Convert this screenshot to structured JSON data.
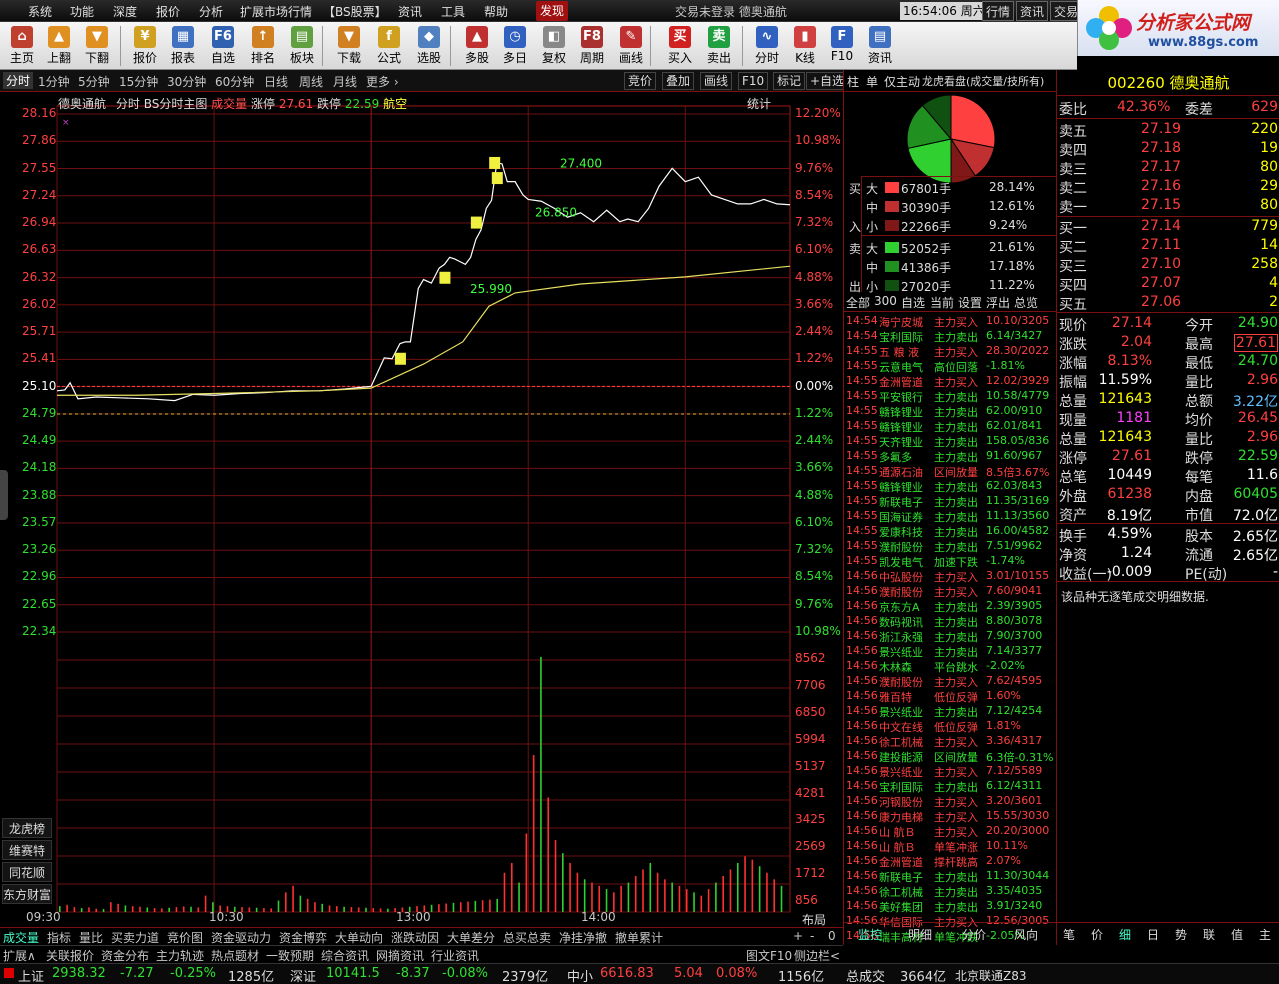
{
  "menu": {
    "items": [
      "系统",
      "功能",
      "深度",
      "报价",
      "分析",
      "扩展市场行情",
      "【BS股票】",
      "资讯",
      "工具",
      "帮助"
    ],
    "discover": "发现",
    "window_title": "交易未登录  德奥通航",
    "clock": "16:54:06",
    "weekday": "周六",
    "right_buttons": [
      "行情",
      "资讯",
      "交易"
    ]
  },
  "logo": {
    "name": "分析家公式网",
    "url": "www.88gs.com"
  },
  "toolbar": [
    "主页",
    "上翻",
    "下翻",
    "报价",
    "报表",
    "自选",
    "排名",
    "板块",
    "下载",
    "公式",
    "选股",
    "多股",
    "多日",
    "复权",
    "周期",
    "画线",
    "买入",
    "卖出",
    "分时",
    "K线",
    "F10",
    "资讯"
  ],
  "period_tabs": {
    "items": [
      "分时",
      "1分钟",
      "5分钟",
      "15分钟",
      "30分钟",
      "60分钟",
      "日线",
      "周线",
      "月线",
      "更多"
    ],
    "buttons": [
      "竞价",
      "叠加",
      "画线",
      "F10",
      "标记",
      "+自选"
    ]
  },
  "chart": {
    "stock": "德奥通航",
    "mode": "分时",
    "formula": "BS分时主图",
    "vol_label": "成交量",
    "limit_up_label": "涨停",
    "limit_up": "27.61",
    "limit_down_label": "跌停",
    "limit_down": "22.59",
    "sector": "航空",
    "stats": "统计",
    "prev_close": 25.1,
    "annotations": [
      {
        "price": 27.4,
        "label": "27.400",
        "side": "卖"
      },
      {
        "price": 25.99,
        "label": "25.990",
        "side": "卖"
      },
      {
        "price": 26.85,
        "label": "26.850",
        "side": "卖"
      }
    ],
    "left_axis": [
      "28.16",
      "27.86",
      "27.55",
      "27.24",
      "26.94",
      "26.63",
      "26.32",
      "26.02",
      "25.71",
      "25.41",
      "25.10",
      "24.79",
      "24.49",
      "24.18",
      "23.88",
      "23.57",
      "23.26",
      "22.96",
      "22.65",
      "22.34"
    ],
    "right_axis": [
      "12.20%",
      "10.98%",
      "9.76%",
      "8.54%",
      "7.32%",
      "6.10%",
      "4.88%",
      "3.66%",
      "2.44%",
      "1.22%",
      "0.00%",
      "1.22%",
      "2.44%",
      "3.66%",
      "4.88%",
      "6.10%",
      "7.32%",
      "8.54%",
      "9.76%",
      "10.98%"
    ],
    "vol_axis": [
      "8562",
      "7706",
      "6850",
      "5994",
      "5137",
      "4281",
      "3425",
      "2569",
      "1712",
      "856"
    ],
    "time_labels": [
      "09:30",
      "10:30",
      "13:00",
      "14:00"
    ],
    "layout_btn": "布局",
    "side_buttons": [
      "龙虎榜",
      "维赛特",
      "同花顺",
      "东方财富"
    ]
  },
  "chart_data": {
    "type": "line",
    "x_range": [
      "09:30",
      "15:00"
    ],
    "ylim": [
      22.34,
      28.16
    ],
    "series": [
      {
        "name": "price",
        "points": [
          [
            0,
            25.05
          ],
          [
            3,
            25.06
          ],
          [
            5,
            25.14
          ],
          [
            8,
            24.96
          ],
          [
            15,
            24.98
          ],
          [
            25,
            24.97
          ],
          [
            35,
            24.96
          ],
          [
            45,
            24.94
          ],
          [
            52,
            25.01
          ],
          [
            60,
            25.0
          ],
          [
            70,
            25.02
          ],
          [
            80,
            25.03
          ],
          [
            90,
            25.05
          ],
          [
            100,
            25.05
          ],
          [
            110,
            25.07
          ],
          [
            120,
            25.1
          ],
          [
            125,
            25.42
          ],
          [
            128,
            25.41
          ],
          [
            131,
            25.58
          ],
          [
            133,
            25.6
          ],
          [
            135,
            25.6
          ],
          [
            138,
            26.2
          ],
          [
            140,
            26.3
          ],
          [
            143,
            26.26
          ],
          [
            146,
            26.43
          ],
          [
            148,
            26.47
          ],
          [
            150,
            26.55
          ],
          [
            152,
            26.53
          ],
          [
            154,
            26.5
          ],
          [
            156,
            26.47
          ],
          [
            158,
            26.55
          ],
          [
            160,
            26.75
          ],
          [
            162,
            26.86
          ],
          [
            164,
            27.1
          ],
          [
            166,
            27.19
          ],
          [
            168,
            27.61
          ],
          [
            170,
            27.6
          ],
          [
            172,
            27.4
          ],
          [
            175,
            27.4
          ],
          [
            178,
            27.25
          ],
          [
            180,
            27.2
          ],
          [
            185,
            27.18
          ],
          [
            190,
            27.1
          ],
          [
            195,
            27.0
          ],
          [
            200,
            27.05
          ],
          [
            205,
            26.95
          ],
          [
            210,
            27.08
          ],
          [
            215,
            26.95
          ],
          [
            218,
            26.98
          ],
          [
            222,
            26.95
          ],
          [
            226,
            27.1
          ],
          [
            230,
            27.35
          ],
          [
            235,
            27.55
          ],
          [
            240,
            27.4
          ],
          [
            245,
            27.45
          ],
          [
            250,
            27.25
          ],
          [
            255,
            27.2
          ],
          [
            260,
            27.15
          ],
          [
            265,
            27.15
          ],
          [
            270,
            27.2
          ],
          [
            275,
            27.15
          ],
          [
            280,
            27.14
          ]
        ]
      },
      {
        "name": "avg",
        "points": [
          [
            0,
            25.0
          ],
          [
            30,
            25.0
          ],
          [
            60,
            25.02
          ],
          [
            100,
            25.05
          ],
          [
            120,
            25.08
          ],
          [
            140,
            25.35
          ],
          [
            155,
            25.6
          ],
          [
            165,
            26.0
          ],
          [
            175,
            26.15
          ],
          [
            200,
            26.25
          ],
          [
            240,
            26.33
          ],
          [
            280,
            26.45
          ]
        ]
      }
    ],
    "volume": [
      180,
      220,
      150,
      120,
      140,
      100,
      90,
      300,
      250,
      200,
      180,
      160,
      140,
      120,
      110,
      130,
      150,
      170,
      160,
      140,
      500,
      300,
      200,
      180,
      160,
      150,
      140,
      130,
      120,
      110,
      350,
      600,
      800,
      500,
      400,
      300,
      250,
      200,
      180,
      160,
      150,
      140,
      130,
      120,
      110,
      100,
      120,
      140,
      160,
      180,
      200,
      220,
      240,
      260,
      280,
      300,
      320,
      340,
      360,
      380,
      400,
      1200,
      1500,
      900,
      2400,
      4800,
      7800,
      3500,
      2200,
      1800,
      1500,
      1200,
      1000,
      900,
      800,
      700,
      600,
      800,
      900,
      1100,
      1300,
      1500,
      1200,
      1000,
      900,
      800,
      700,
      600,
      500,
      700,
      900,
      1100,
      1300,
      1500,
      1700,
      1600,
      1400,
      1200,
      1000,
      800
    ]
  },
  "bottom_tabs": [
    "成交量",
    "指标",
    "量比",
    "买卖力道",
    "竞价图",
    "资金驱动力",
    "资金博弈",
    "大单动向",
    "涨跌动因",
    "大单差分",
    "总买总卖",
    "净挂净撤",
    "撤单累计"
  ],
  "bottom_tabs2": [
    "扩展∧",
    "关联报价",
    "资金分布",
    "主力轨迹",
    "热点题材",
    "一致预期",
    "综合资讯",
    "网摘资讯",
    "行业资讯"
  ],
  "bottom_right": [
    "图文F10",
    "侧边栏<"
  ],
  "status": {
    "sh_name": "上证",
    "sh_val": "2938.32",
    "sh_chg": "-7.27",
    "sh_pct": "-0.25%",
    "sh_amt": "1285亿",
    "sz_name": "深证",
    "sz_val": "10141.5",
    "sz_chg": "-8.37",
    "sz_pct": "-0.08%",
    "sz_amt": "2379亿",
    "zx_name": "中小",
    "zx_val": "6616.83",
    "zx_chg": "5.04",
    "zx_pct": "0.08%",
    "zx_amt": "1156亿",
    "total_label": "总成交",
    "total": "3664亿",
    "conn": "北京联通Z83"
  },
  "mid": {
    "tabs": [
      "柱",
      "单",
      "仅主动",
      "龙虎看盘(成交量/技所有)"
    ],
    "pie": [
      {
        "value": 28.14,
        "color": "#ff4040"
      },
      {
        "value": 12.61,
        "color": "#c03030"
      },
      {
        "value": 9.24,
        "color": "#801818"
      },
      {
        "value": 21.61,
        "color": "#30d030"
      },
      {
        "value": 17.18,
        "color": "#209020"
      },
      {
        "value": 11.22,
        "color": "#105010"
      }
    ],
    "flow": [
      {
        "side": "买",
        "size": "大",
        "vol": "67801手",
        "pct": "28.14%",
        "color": "#ff4040"
      },
      {
        "side": "",
        "size": "中",
        "vol": "30390手",
        "pct": "12.61%",
        "color": "#c03030"
      },
      {
        "side": "入",
        "size": "小",
        "vol": "22266手",
        "pct": "9.24%",
        "color": "#801818"
      },
      {
        "side": "卖",
        "size": "大",
        "vol": "52052手",
        "pct": "21.61%",
        "color": "#30d030"
      },
      {
        "side": "",
        "size": "中",
        "vol": "41386手",
        "pct": "17.18%",
        "color": "#209020"
      },
      {
        "side": "出",
        "size": "小",
        "vol": "27020手",
        "pct": "11.22%",
        "color": "#105010"
      }
    ],
    "filters": [
      "全部",
      "300",
      "自选",
      "当前",
      "设置",
      "浮出",
      "总览"
    ],
    "deals": [
      [
        "14:54",
        "海宁皮城",
        "主力买入",
        "10.10/3205",
        "r"
      ],
      [
        "14:54",
        "宝利国际",
        "主力卖出",
        "6.14/3427",
        "g"
      ],
      [
        "14:55",
        "五 粮 液",
        "主力买入",
        "28.30/2022",
        "r"
      ],
      [
        "14:55",
        "云意电气",
        "高位回落",
        "-1.81%",
        "g"
      ],
      [
        "14:55",
        "金洲管道",
        "主力买入",
        "12.02/3929",
        "r"
      ],
      [
        "14:55",
        "平安银行",
        "主力卖出",
        "10.58/4779",
        "g"
      ],
      [
        "14:55",
        "赣锋锂业",
        "主力卖出",
        "62.00/910",
        "g"
      ],
      [
        "14:55",
        "赣锋锂业",
        "主力卖出",
        "62.01/841",
        "g"
      ],
      [
        "14:55",
        "天齐锂业",
        "主力卖出",
        "158.05/836",
        "g"
      ],
      [
        "14:55",
        "多氟多",
        "主力卖出",
        "91.60/967",
        "g"
      ],
      [
        "14:55",
        "通源石油",
        "区间放量",
        "8.5倍3.67%",
        "r"
      ],
      [
        "14:55",
        "赣锋锂业",
        "主力卖出",
        "62.03/843",
        "g"
      ],
      [
        "14:55",
        "新联电子",
        "主力卖出",
        "11.35/3169",
        "g"
      ],
      [
        "14:55",
        "国海证券",
        "主力卖出",
        "11.13/3560",
        "g"
      ],
      [
        "14:55",
        "爱康科技",
        "主力卖出",
        "16.00/4582",
        "g"
      ],
      [
        "14:55",
        "濮耐股份",
        "主力卖出",
        "7.51/9962",
        "g"
      ],
      [
        "14:55",
        "凯发电气",
        "加速下跌",
        "-1.74%",
        "g"
      ],
      [
        "14:56",
        "中弘股份",
        "主力买入",
        "3.01/10155",
        "r"
      ],
      [
        "14:56",
        "濮耐股份",
        "主力买入",
        "7.60/9041",
        "r"
      ],
      [
        "14:56",
        "京东方A",
        "主力卖出",
        "2.39/3905",
        "g"
      ],
      [
        "14:56",
        "数码视讯",
        "主力卖出",
        "8.80/3078",
        "g"
      ],
      [
        "14:56",
        "浙江永强",
        "主力卖出",
        "7.90/3700",
        "g"
      ],
      [
        "14:56",
        "景兴纸业",
        "主力卖出",
        "7.14/3377",
        "g"
      ],
      [
        "14:56",
        "木林森",
        "平台跳水",
        "-2.02%",
        "g"
      ],
      [
        "14:56",
        "濮耐股份",
        "主力买入",
        "7.62/4595",
        "r"
      ],
      [
        "14:56",
        "雅百特",
        "低位反弹",
        "1.60%",
        "r"
      ],
      [
        "14:56",
        "景兴纸业",
        "主力卖出",
        "7.12/4254",
        "g"
      ],
      [
        "14:56",
        "中文在线",
        "低位反弹",
        "1.81%",
        "r"
      ],
      [
        "14:56",
        "徐工机械",
        "主力买入",
        "3.36/4317",
        "r"
      ],
      [
        "14:56",
        "建投能源",
        "区间放量",
        "6.3倍-0.31%",
        "g"
      ],
      [
        "14:56",
        "景兴纸业",
        "主力买入",
        "7.12/5589",
        "r"
      ],
      [
        "14:56",
        "宝利国际",
        "主力卖出",
        "6.12/4311",
        "g"
      ],
      [
        "14:56",
        "河钢股份",
        "主力买入",
        "3.20/3601",
        "r"
      ],
      [
        "14:56",
        "康力电梯",
        "主力买入",
        "15.55/3030",
        "r"
      ],
      [
        "14:56",
        "山 航Ｂ",
        "主力买入",
        "20.20/3000",
        "r"
      ],
      [
        "14:56",
        "山 航Ｂ",
        "单笔冲涨",
        "10.11%",
        "r"
      ],
      [
        "14:56",
        "金洲管道",
        "撑杆跳高",
        "2.07%",
        "r"
      ],
      [
        "14:56",
        "新联电子",
        "主力卖出",
        "11.30/3044",
        "g"
      ],
      [
        "14:56",
        "徐工机械",
        "主力卖出",
        "3.35/4035",
        "g"
      ],
      [
        "14:56",
        "美好集团",
        "主力卖出",
        "3.91/3240",
        "g"
      ],
      [
        "14:56",
        "华信国际",
        "主力买入",
        "12.56/3005",
        "r"
      ],
      [
        "14:56",
        "瑞丰高材",
        "单笔冲跌",
        "-2.05%",
        "g"
      ]
    ],
    "bottom": [
      "监控",
      "明细",
      "分价",
      "风向"
    ]
  },
  "right": {
    "title": "002260 德奥通航",
    "weibi_label": "委比",
    "weibi": "42.36%",
    "weicha_label": "委差",
    "weicha": "629",
    "asks": [
      [
        "卖五",
        "27.19",
        "220"
      ],
      [
        "卖四",
        "27.18",
        "19"
      ],
      [
        "卖三",
        "27.17",
        "80"
      ],
      [
        "卖二",
        "27.16",
        "29"
      ],
      [
        "卖一",
        "27.15",
        "80"
      ]
    ],
    "bids": [
      [
        "买一",
        "27.14",
        "779"
      ],
      [
        "买二",
        "27.11",
        "14"
      ],
      [
        "买三",
        "27.10",
        "258"
      ],
      [
        "买四",
        "27.07",
        "4"
      ],
      [
        "买五",
        "27.06",
        "2"
      ]
    ],
    "quote": [
      [
        "现价",
        "27.14",
        "r",
        "今开",
        "24.90",
        "g"
      ],
      [
        "涨跌",
        "2.04",
        "r",
        "最高",
        "27.61",
        "r"
      ],
      [
        "涨幅",
        "8.13%",
        "r",
        "最低",
        "24.70",
        "g"
      ],
      [
        "振幅",
        "11.59%",
        "w",
        "量比",
        "2.96",
        "r"
      ],
      [
        "总量",
        "121643",
        "y",
        "总额",
        "3.22亿",
        "c"
      ],
      [
        "现量",
        "1181",
        "m",
        "均价",
        "26.45",
        "r"
      ],
      [
        "总量",
        "121643",
        "y",
        "量比",
        "2.96",
        "r"
      ],
      [
        "涨停",
        "27.61",
        "r",
        "跌停",
        "22.59",
        "g"
      ],
      [
        "总笔",
        "10449",
        "w",
        "每笔",
        "11.6",
        "w"
      ],
      [
        "外盘",
        "61238",
        "r",
        "内盘",
        "60405",
        "g"
      ],
      [
        "资产",
        "8.19亿",
        "w",
        "市值",
        "72.0亿",
        "w"
      ]
    ],
    "quote2": [
      [
        "换手",
        "4.59%",
        "w",
        "股本",
        "2.65亿",
        "w"
      ],
      [
        "净资",
        "1.24",
        "w",
        "流通",
        "2.65亿",
        "w"
      ],
      [
        "收益(一)",
        "-0.009",
        "w",
        "PE(动)",
        "-",
        "w"
      ]
    ],
    "note": "该品种无逐笔成交明细数据.",
    "bottom": [
      "笔",
      "价",
      "细",
      "日",
      "势",
      "联",
      "值",
      "主"
    ]
  }
}
